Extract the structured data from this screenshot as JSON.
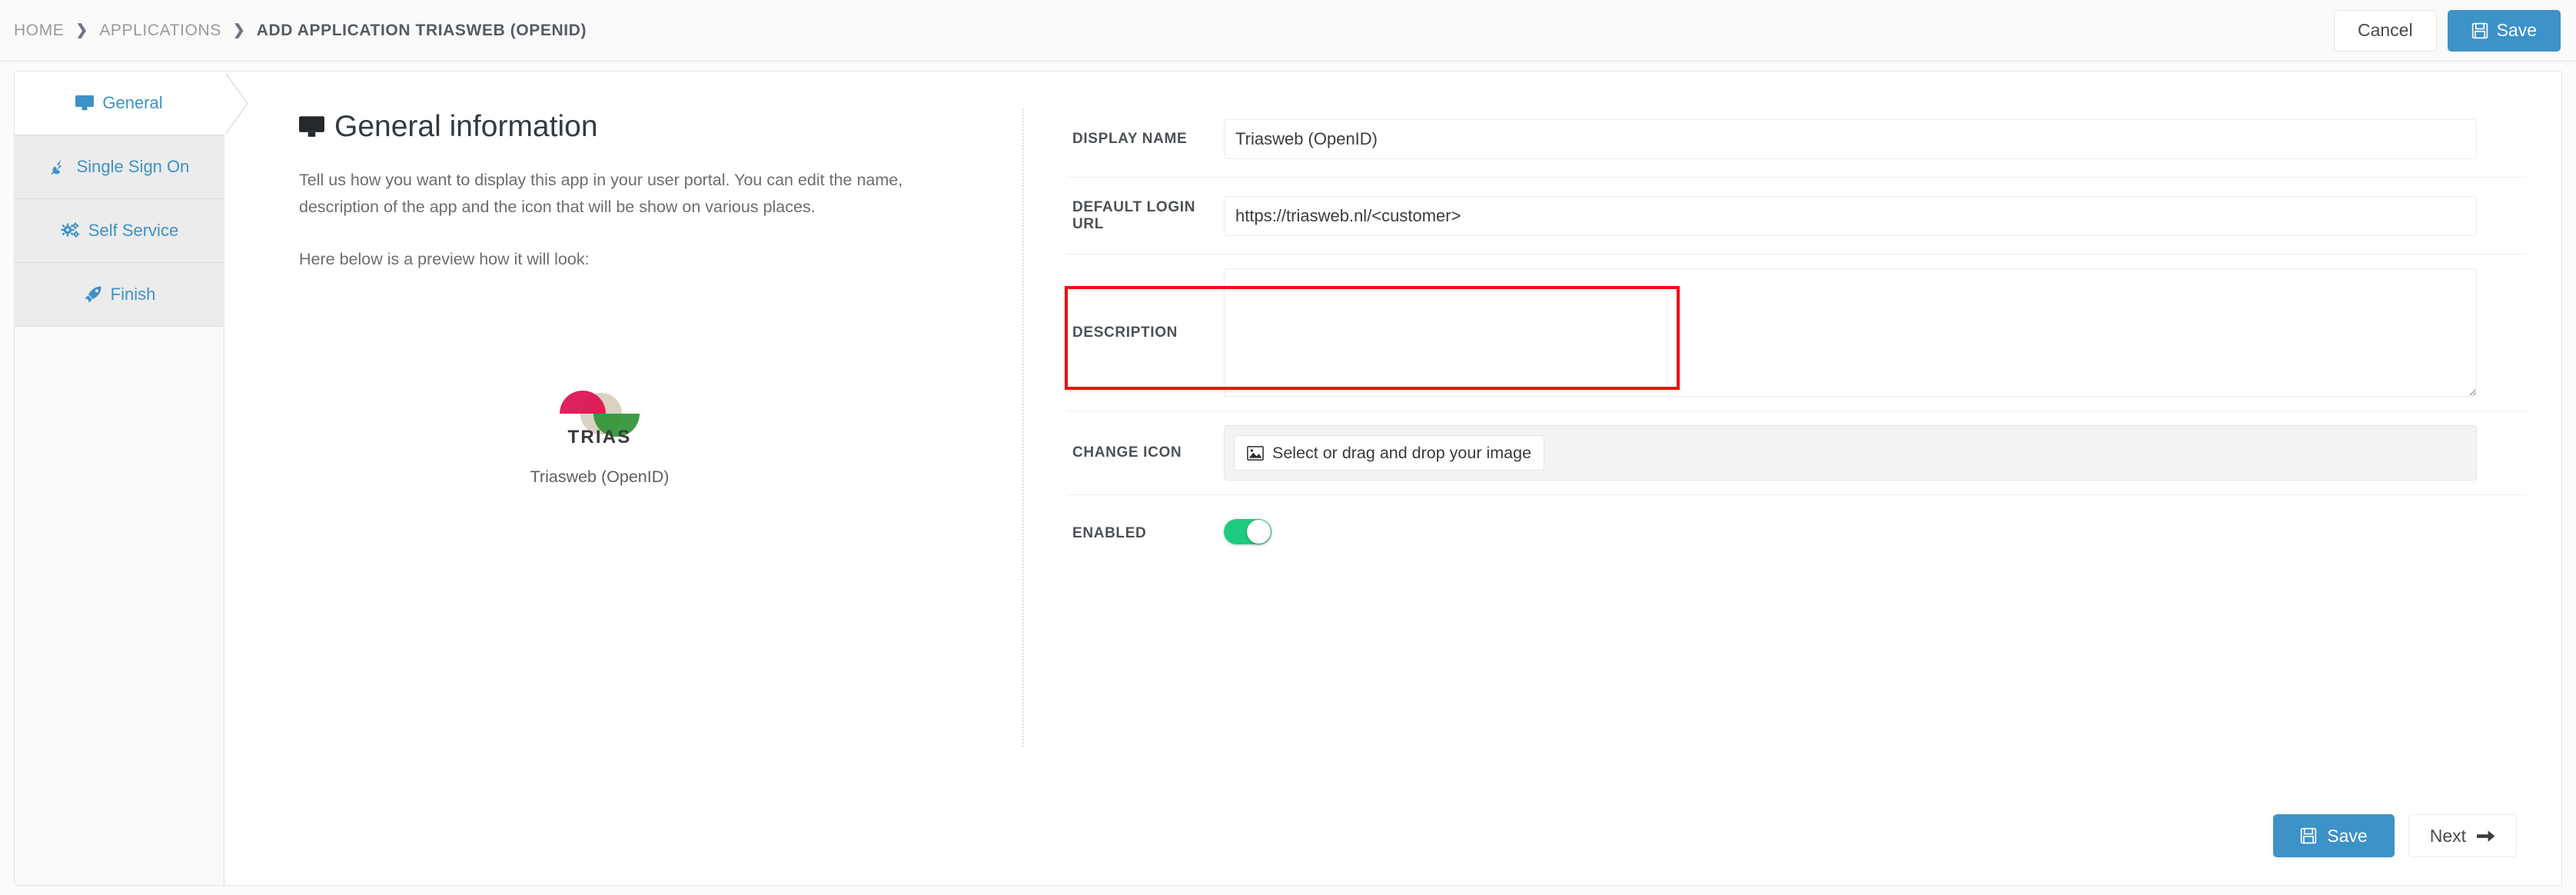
{
  "header": {
    "breadcrumb": [
      {
        "label": "HOME",
        "current": false
      },
      {
        "label": "APPLICATIONS",
        "current": false
      },
      {
        "label": "ADD APPLICATION TRIASWEB (OPENID)",
        "current": true
      }
    ],
    "separator": "❯",
    "cancel_label": "Cancel",
    "save_label": "Save",
    "save_icon": "floppy-disk-icon"
  },
  "wizard": {
    "items": [
      {
        "label": "General",
        "icon": "desktop-icon",
        "active": true
      },
      {
        "label": "Single Sign On",
        "icon": "plug-icon",
        "active": false
      },
      {
        "label": "Self Service",
        "icon": "gears-icon",
        "active": false
      },
      {
        "label": "Finish",
        "icon": "rocket-icon",
        "active": false
      }
    ]
  },
  "info": {
    "title": "General information",
    "title_icon": "desktop-icon",
    "description": "Tell us how you want to display this app in your user portal. You can edit the name, description of the app and the icon that will be show on various places.",
    "preview_label": "Here below is a preview how it will look:",
    "app_name": "Triasweb (OpenID)",
    "logo": {
      "wordmark": "TRIAS",
      "colors": {
        "crimson": "#dd1050",
        "beige": "#d8d1c4",
        "green": "#2f9436"
      }
    }
  },
  "form": {
    "display_name": {
      "label": "DISPLAY NAME",
      "value": "Triasweb (OpenID)",
      "placeholder": ""
    },
    "default_login_url": {
      "label": "DEFAULT LOGIN URL",
      "value": "https://triasweb.nl/<customer>",
      "placeholder": "",
      "highlighted": true
    },
    "description": {
      "label": "DESCRIPTION",
      "value": "",
      "placeholder": ""
    },
    "change_icon": {
      "label": "CHANGE ICON",
      "button_label": "Select or drag and drop your image",
      "button_icon": "image-icon"
    },
    "enabled": {
      "label": "ENABLED",
      "value": true
    }
  },
  "footer": {
    "save_label": "Save",
    "save_icon": "floppy-disk-icon",
    "next_label": "Next",
    "next_icon": "arrow-right-icon"
  },
  "colors": {
    "accent": "#3d92c8",
    "toggle_on": "#1fcb80",
    "highlight": "#f20b0b"
  }
}
